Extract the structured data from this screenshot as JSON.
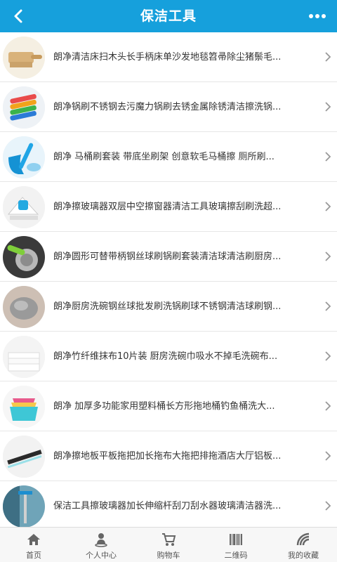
{
  "header": {
    "title": "保洁工具",
    "back_icon": "chevron-left-icon",
    "more_icon": "more-dots-icon",
    "color": "#16a0dc"
  },
  "products": [
    {
      "title": "朗净清洁床扫木头长手柄床单沙发地毯笤帚除尘猪鬃毛...",
      "thumb": "bed-brush-image"
    },
    {
      "title": "朗净锅刷不锈钢去污魔力锅刷去锈金属除锈清洁擦洗锅...",
      "thumb": "colorful-sponges-image"
    },
    {
      "title": "朗净 马桶刷套装 带底坐刷架 创意软毛马桶擦 厕所刷...",
      "thumb": "toilet-brush-image"
    },
    {
      "title": "朗净擦玻璃器双层中空擦窗器清洁工具玻璃擦刮刷洗超...",
      "thumb": "window-cleaner-image"
    },
    {
      "title": "朗净圆形可替带柄钢丝球刷锅刷套装清洁球清洁刷厨房...",
      "thumb": "steel-wool-brush-image"
    },
    {
      "title": "朗净厨房洗碗钢丝球批发刷洗锅刷球不锈钢清洁球刷钢...",
      "thumb": "steel-wool-ball-image"
    },
    {
      "title": "朗净竹纤维抹布10片装 厨房洗碗巾吸水不掉毛洗碗布...",
      "thumb": "dish-cloth-image"
    },
    {
      "title": "朗净 加厚多功能家用塑料桶长方形拖地桶钓鱼桶洗大...",
      "thumb": "plastic-bucket-image"
    },
    {
      "title": "朗净擦地板平板拖把加长拖布大拖把排拖酒店大厅铝板...",
      "thumb": "flat-mop-image"
    },
    {
      "title": "保洁工具擦玻璃器加长伸缩杆刮刀刮水器玻璃清洁器洗...",
      "thumb": "glass-squeegee-image"
    }
  ],
  "tabbar": [
    {
      "label": "首页",
      "icon": "home-icon"
    },
    {
      "label": "个人中心",
      "icon": "user-center-icon"
    },
    {
      "label": "购物车",
      "icon": "cart-icon"
    },
    {
      "label": "二维码",
      "icon": "barcode-icon"
    },
    {
      "label": "我的收藏",
      "icon": "favorites-icon"
    }
  ]
}
